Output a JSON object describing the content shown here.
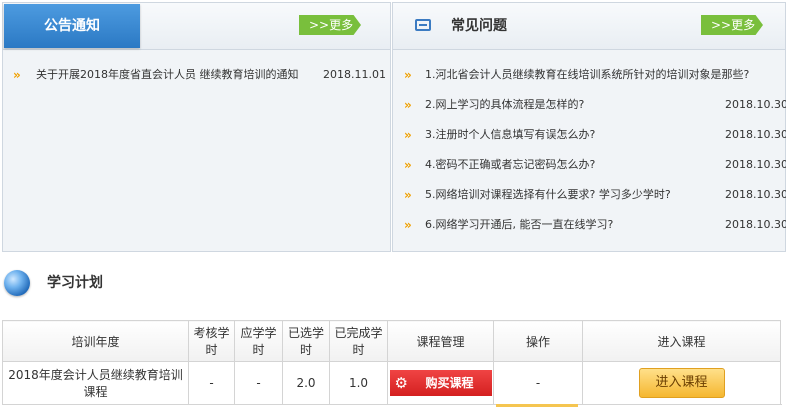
{
  "notice": {
    "title": "公告通知",
    "more": ">>更多",
    "items": [
      {
        "text": "关于开展2018年度省直会计人员 继续教育培训的通知",
        "date": "2018.11.01"
      }
    ]
  },
  "faq": {
    "title": "常见问题",
    "more": ">>更多",
    "items": [
      {
        "text": "1.河北省会计人员继续教育在线培训系统所针对的培训对象是那些?",
        "date": ""
      },
      {
        "text": "2.网上学习的具体流程是怎样的?",
        "date": "2018.10.30"
      },
      {
        "text": "3.注册时个人信息填写有误怎么办?",
        "date": "2018.10.30"
      },
      {
        "text": "4.密码不正确或者忘记密码怎么办?",
        "date": "2018.10.30"
      },
      {
        "text": "5.网络培训对课程选择有什么要求? 学习多少学时?",
        "date": "2018.10.30"
      },
      {
        "text": "6.网络学习开通后, 能否一直在线学习?",
        "date": "2018.10.30"
      }
    ]
  },
  "plan": {
    "title": "学习计划",
    "headers": [
      "培训年度",
      "考核学时",
      "应学学时",
      "已选学时",
      "已完成学时",
      "课程管理",
      "操作",
      "进入课程"
    ],
    "rows": [
      {
        "year": "2018年度会计人员继续教育培训课程",
        "exam": "-",
        "required": "-",
        "selected": "2.0",
        "completed": "1.0",
        "manage_btn": "购买课程",
        "action": "-",
        "enter_btn": "进入课程"
      }
    ]
  }
}
